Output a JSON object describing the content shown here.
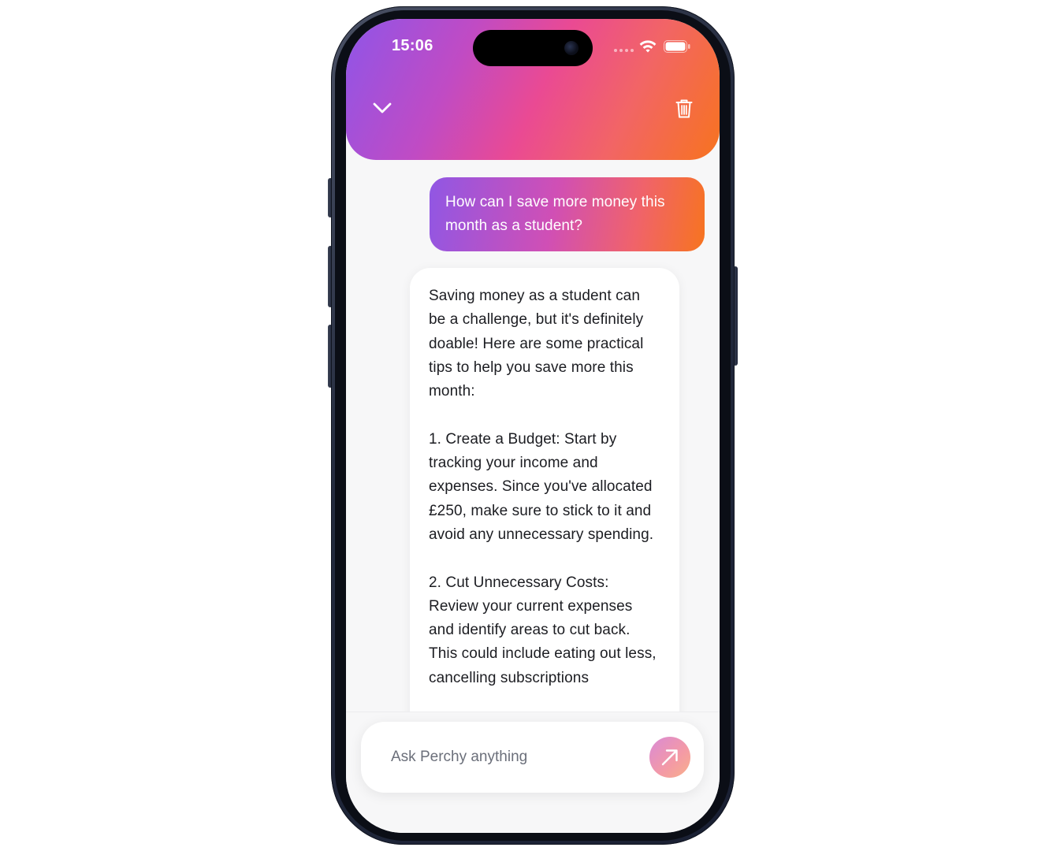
{
  "status_bar": {
    "time": "15:06",
    "wifi_icon": "wifi-icon",
    "battery_icon": "battery-icon"
  },
  "header": {
    "back_icon": "chevron-down-icon",
    "delete_icon": "trash-icon",
    "gradient_colors": [
      "#8f55e8",
      "#ea4a93",
      "#f7731f"
    ]
  },
  "messages": [
    {
      "role": "user",
      "text": "How can I save more money this month as a student?"
    },
    {
      "role": "assistant",
      "text": "Saving money as a student can be a challenge, but it's definitely doable! Here are some practical tips to help you save more this month:\n\n1. Create a Budget: Start by tracking your income and expenses. Since you've allocated £250, make sure to stick to it and avoid any unnecessary spending.\n\n2. Cut Unnecessary Costs: Review your current expenses and identify areas to cut back. This could include eating out less, cancelling subscriptions"
    }
  ],
  "composer": {
    "placeholder": "Ask Perchy anything",
    "value": "",
    "send_icon": "arrow-up-right-icon"
  }
}
